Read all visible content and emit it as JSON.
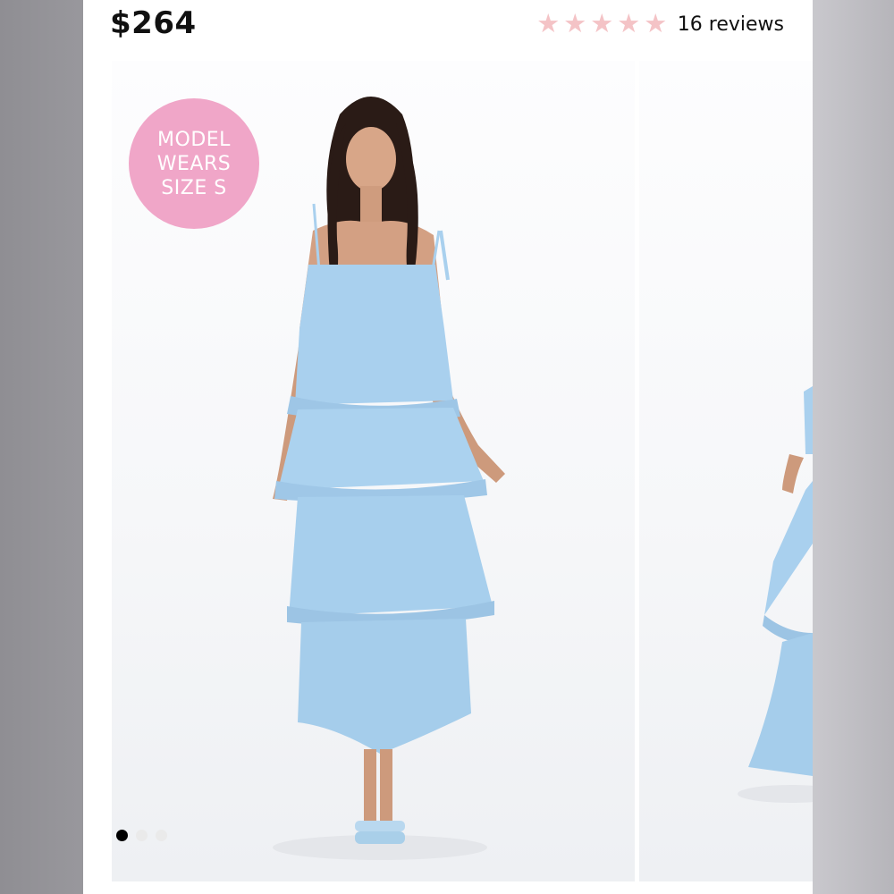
{
  "product": {
    "price": "$264",
    "rating": {
      "stars_filled": 0,
      "stars_total": 5,
      "reviews_label": "16 reviews"
    }
  },
  "gallery": {
    "badge_lines": [
      "MODEL",
      "WEARS",
      "SIZE S"
    ],
    "pager": {
      "count": 3,
      "active_index": 0
    }
  },
  "colors": {
    "badge": "#f0a6c8",
    "star": "#f4c3c6",
    "dress": "#a9d0ee"
  }
}
